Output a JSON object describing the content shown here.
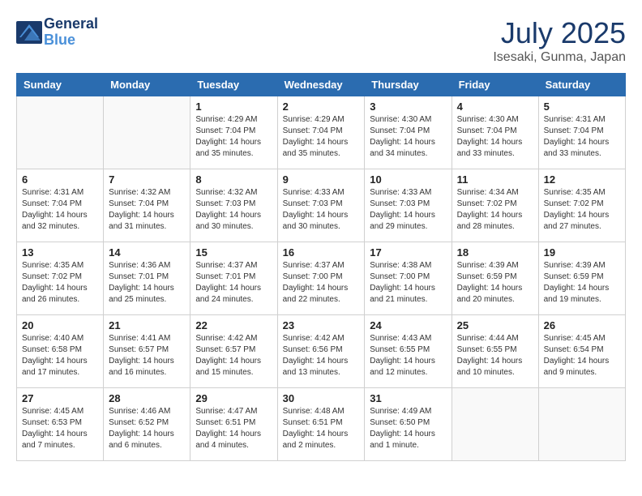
{
  "logo": {
    "line1": "General",
    "line2": "Blue"
  },
  "title": "July 2025",
  "location": "Isesaki, Gunma, Japan",
  "weekdays": [
    "Sunday",
    "Monday",
    "Tuesday",
    "Wednesday",
    "Thursday",
    "Friday",
    "Saturday"
  ],
  "weeks": [
    [
      {
        "day": "",
        "info": ""
      },
      {
        "day": "",
        "info": ""
      },
      {
        "day": "1",
        "info": "Sunrise: 4:29 AM\nSunset: 7:04 PM\nDaylight: 14 hours and 35 minutes."
      },
      {
        "day": "2",
        "info": "Sunrise: 4:29 AM\nSunset: 7:04 PM\nDaylight: 14 hours and 35 minutes."
      },
      {
        "day": "3",
        "info": "Sunrise: 4:30 AM\nSunset: 7:04 PM\nDaylight: 14 hours and 34 minutes."
      },
      {
        "day": "4",
        "info": "Sunrise: 4:30 AM\nSunset: 7:04 PM\nDaylight: 14 hours and 33 minutes."
      },
      {
        "day": "5",
        "info": "Sunrise: 4:31 AM\nSunset: 7:04 PM\nDaylight: 14 hours and 33 minutes."
      }
    ],
    [
      {
        "day": "6",
        "info": "Sunrise: 4:31 AM\nSunset: 7:04 PM\nDaylight: 14 hours and 32 minutes."
      },
      {
        "day": "7",
        "info": "Sunrise: 4:32 AM\nSunset: 7:04 PM\nDaylight: 14 hours and 31 minutes."
      },
      {
        "day": "8",
        "info": "Sunrise: 4:32 AM\nSunset: 7:03 PM\nDaylight: 14 hours and 30 minutes."
      },
      {
        "day": "9",
        "info": "Sunrise: 4:33 AM\nSunset: 7:03 PM\nDaylight: 14 hours and 30 minutes."
      },
      {
        "day": "10",
        "info": "Sunrise: 4:33 AM\nSunset: 7:03 PM\nDaylight: 14 hours and 29 minutes."
      },
      {
        "day": "11",
        "info": "Sunrise: 4:34 AM\nSunset: 7:02 PM\nDaylight: 14 hours and 28 minutes."
      },
      {
        "day": "12",
        "info": "Sunrise: 4:35 AM\nSunset: 7:02 PM\nDaylight: 14 hours and 27 minutes."
      }
    ],
    [
      {
        "day": "13",
        "info": "Sunrise: 4:35 AM\nSunset: 7:02 PM\nDaylight: 14 hours and 26 minutes."
      },
      {
        "day": "14",
        "info": "Sunrise: 4:36 AM\nSunset: 7:01 PM\nDaylight: 14 hours and 25 minutes."
      },
      {
        "day": "15",
        "info": "Sunrise: 4:37 AM\nSunset: 7:01 PM\nDaylight: 14 hours and 24 minutes."
      },
      {
        "day": "16",
        "info": "Sunrise: 4:37 AM\nSunset: 7:00 PM\nDaylight: 14 hours and 22 minutes."
      },
      {
        "day": "17",
        "info": "Sunrise: 4:38 AM\nSunset: 7:00 PM\nDaylight: 14 hours and 21 minutes."
      },
      {
        "day": "18",
        "info": "Sunrise: 4:39 AM\nSunset: 6:59 PM\nDaylight: 14 hours and 20 minutes."
      },
      {
        "day": "19",
        "info": "Sunrise: 4:39 AM\nSunset: 6:59 PM\nDaylight: 14 hours and 19 minutes."
      }
    ],
    [
      {
        "day": "20",
        "info": "Sunrise: 4:40 AM\nSunset: 6:58 PM\nDaylight: 14 hours and 17 minutes."
      },
      {
        "day": "21",
        "info": "Sunrise: 4:41 AM\nSunset: 6:57 PM\nDaylight: 14 hours and 16 minutes."
      },
      {
        "day": "22",
        "info": "Sunrise: 4:42 AM\nSunset: 6:57 PM\nDaylight: 14 hours and 15 minutes."
      },
      {
        "day": "23",
        "info": "Sunrise: 4:42 AM\nSunset: 6:56 PM\nDaylight: 14 hours and 13 minutes."
      },
      {
        "day": "24",
        "info": "Sunrise: 4:43 AM\nSunset: 6:55 PM\nDaylight: 14 hours and 12 minutes."
      },
      {
        "day": "25",
        "info": "Sunrise: 4:44 AM\nSunset: 6:55 PM\nDaylight: 14 hours and 10 minutes."
      },
      {
        "day": "26",
        "info": "Sunrise: 4:45 AM\nSunset: 6:54 PM\nDaylight: 14 hours and 9 minutes."
      }
    ],
    [
      {
        "day": "27",
        "info": "Sunrise: 4:45 AM\nSunset: 6:53 PM\nDaylight: 14 hours and 7 minutes."
      },
      {
        "day": "28",
        "info": "Sunrise: 4:46 AM\nSunset: 6:52 PM\nDaylight: 14 hours and 6 minutes."
      },
      {
        "day": "29",
        "info": "Sunrise: 4:47 AM\nSunset: 6:51 PM\nDaylight: 14 hours and 4 minutes."
      },
      {
        "day": "30",
        "info": "Sunrise: 4:48 AM\nSunset: 6:51 PM\nDaylight: 14 hours and 2 minutes."
      },
      {
        "day": "31",
        "info": "Sunrise: 4:49 AM\nSunset: 6:50 PM\nDaylight: 14 hours and 1 minute."
      },
      {
        "day": "",
        "info": ""
      },
      {
        "day": "",
        "info": ""
      }
    ]
  ]
}
